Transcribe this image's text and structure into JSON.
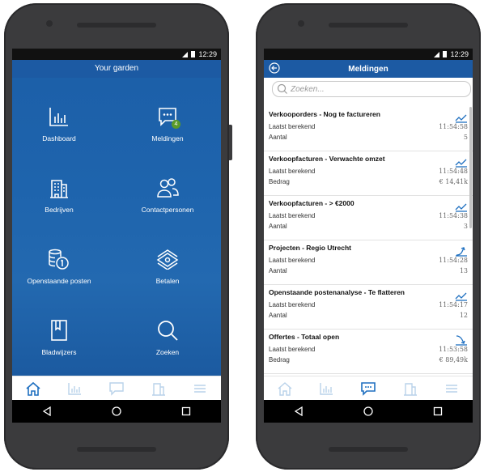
{
  "left_phone": {
    "status_time": "12:29",
    "header_title": "Your garden",
    "tiles": [
      {
        "label": "Dashboard",
        "icon": "bar-chart-icon"
      },
      {
        "label": "Meldingen",
        "icon": "chat-bubble-icon",
        "badge": "4"
      },
      {
        "label": "Bedrijven",
        "icon": "building-icon"
      },
      {
        "label": "Contactpersonen",
        "icon": "people-icon"
      },
      {
        "label": "Openstaande posten",
        "icon": "coins-icon"
      },
      {
        "label": "Betalen",
        "icon": "money-stack-icon"
      },
      {
        "label": "Bladwijzers",
        "icon": "bookmark-icon"
      },
      {
        "label": "Zoeken",
        "icon": "search-icon"
      }
    ],
    "tabbar": [
      "home-icon",
      "chart-icon",
      "chat-icon",
      "building-icon",
      "menu-icon"
    ],
    "active_tab": 0
  },
  "right_phone": {
    "status_time": "12:29",
    "title": "Meldingen",
    "search_placeholder": "Zoeken...",
    "notifications": [
      {
        "title": "Verkooporders - Nog te factureren",
        "line1_label": "Laatst berekend",
        "line1_value": "11:54:58",
        "line2_label": "Aantal",
        "line2_value": "5",
        "trend": "up"
      },
      {
        "title": "Verkoopfacturen - Verwachte omzet",
        "line1_label": "Laatst berekend",
        "line1_value": "11:54:48",
        "line2_label": "Bedrag",
        "line2_value": "€ 14,41k",
        "trend": "up"
      },
      {
        "title": "Verkoopfacturen - > €2000",
        "line1_label": "Laatst berekend",
        "line1_value": "11:54:38",
        "line2_label": "Aantal",
        "line2_value": "3",
        "trend": "up"
      },
      {
        "title": "Projecten - Regio Utrecht",
        "line1_label": "Laatst berekend",
        "line1_value": "11:54:28",
        "line2_label": "Aantal",
        "line2_value": "13",
        "trend": "rise"
      },
      {
        "title": "Openstaande postenanalyse - Te flatteren",
        "line1_label": "Laatst berekend",
        "line1_value": "11:54:17",
        "line2_label": "Aantal",
        "line2_value": "12",
        "trend": "up"
      },
      {
        "title": "Offertes - Totaal open",
        "line1_label": "Laatst berekend",
        "line1_value": "11:53:58",
        "line2_label": "Bedrag",
        "line2_value": "€ 89,49k",
        "trend": "down"
      }
    ],
    "tabbar": [
      "home-icon",
      "chart-icon",
      "chat-icon",
      "building-icon",
      "menu-icon"
    ],
    "active_tab": 2
  },
  "colors": {
    "brand": "#1c5aa3",
    "icon_active": "#1e6fc0",
    "icon_inactive": "#b9d2ea"
  }
}
